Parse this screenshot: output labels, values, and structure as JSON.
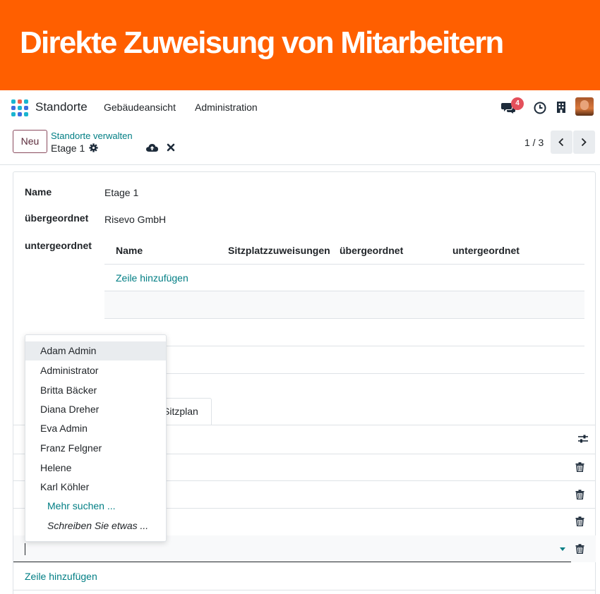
{
  "banner": {
    "title": "Direkte Zuweisung von Mitarbeitern"
  },
  "navbar": {
    "app_name": "Standorte",
    "menu": [
      "Gebäudeansicht",
      "Administration"
    ],
    "notification_count": "4"
  },
  "control": {
    "new_button": "Neu",
    "breadcrumb": "Standorte verwalten",
    "record_name": "Etage 1",
    "pager": "1 / 3"
  },
  "form": {
    "name_label": "Name",
    "name_value": "Etage 1",
    "parent_label": "übergeordnet",
    "parent_value": "Risevo GmbH",
    "children_label": "untergeordnet",
    "children_columns": [
      "Name",
      "Sitzplatzzuweisungen",
      "übergeordnet",
      "untergeordnet"
    ],
    "children_add_line": "Zeile hinzufügen",
    "tab_label": "Sitzplan",
    "add_line": "Zeile hinzufügen"
  },
  "dropdown": {
    "items": [
      "Adam Admin",
      "Administrator",
      "Britta Bäcker",
      "Diana Dreher",
      "Eva Admin",
      "Franz Felgner",
      "Helene",
      "Karl Köhler"
    ],
    "search_more": "Mehr suchen ...",
    "write_hint": "Schreiben Sie etwas ..."
  },
  "colors": {
    "brand": "#ff5f00",
    "accent": "#017e84",
    "badge": "#e4505b"
  }
}
